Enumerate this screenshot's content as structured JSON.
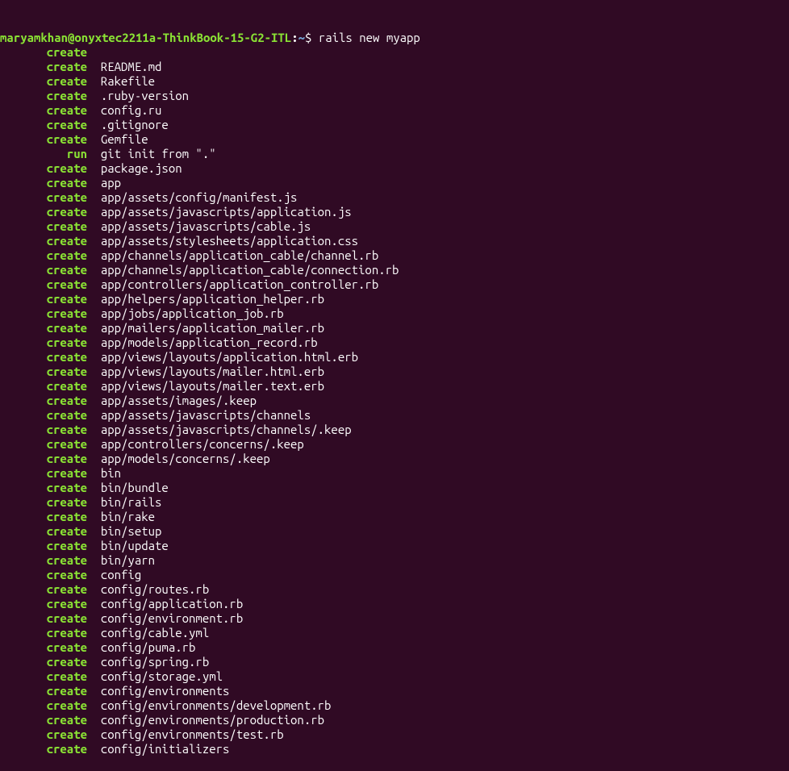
{
  "prompt": {
    "user_host": "maryamkhan@onyxtec2211a-ThinkBook-15-G2-ITL",
    "colon": ":",
    "path": "~",
    "dollar": "$",
    "command": "rails new myapp"
  },
  "lines": [
    {
      "action": "create",
      "path": ""
    },
    {
      "action": "create",
      "path": "README.md"
    },
    {
      "action": "create",
      "path": "Rakefile"
    },
    {
      "action": "create",
      "path": ".ruby-version"
    },
    {
      "action": "create",
      "path": "config.ru"
    },
    {
      "action": "create",
      "path": ".gitignore"
    },
    {
      "action": "create",
      "path": "Gemfile"
    },
    {
      "action": "run",
      "path": "git init from \".\""
    },
    {
      "action": "create",
      "path": "package.json"
    },
    {
      "action": "create",
      "path": "app"
    },
    {
      "action": "create",
      "path": "app/assets/config/manifest.js"
    },
    {
      "action": "create",
      "path": "app/assets/javascripts/application.js"
    },
    {
      "action": "create",
      "path": "app/assets/javascripts/cable.js"
    },
    {
      "action": "create",
      "path": "app/assets/stylesheets/application.css"
    },
    {
      "action": "create",
      "path": "app/channels/application_cable/channel.rb"
    },
    {
      "action": "create",
      "path": "app/channels/application_cable/connection.rb"
    },
    {
      "action": "create",
      "path": "app/controllers/application_controller.rb"
    },
    {
      "action": "create",
      "path": "app/helpers/application_helper.rb"
    },
    {
      "action": "create",
      "path": "app/jobs/application_job.rb"
    },
    {
      "action": "create",
      "path": "app/mailers/application_mailer.rb"
    },
    {
      "action": "create",
      "path": "app/models/application_record.rb"
    },
    {
      "action": "create",
      "path": "app/views/layouts/application.html.erb"
    },
    {
      "action": "create",
      "path": "app/views/layouts/mailer.html.erb"
    },
    {
      "action": "create",
      "path": "app/views/layouts/mailer.text.erb"
    },
    {
      "action": "create",
      "path": "app/assets/images/.keep"
    },
    {
      "action": "create",
      "path": "app/assets/javascripts/channels"
    },
    {
      "action": "create",
      "path": "app/assets/javascripts/channels/.keep"
    },
    {
      "action": "create",
      "path": "app/controllers/concerns/.keep"
    },
    {
      "action": "create",
      "path": "app/models/concerns/.keep"
    },
    {
      "action": "create",
      "path": "bin"
    },
    {
      "action": "create",
      "path": "bin/bundle"
    },
    {
      "action": "create",
      "path": "bin/rails"
    },
    {
      "action": "create",
      "path": "bin/rake"
    },
    {
      "action": "create",
      "path": "bin/setup"
    },
    {
      "action": "create",
      "path": "bin/update"
    },
    {
      "action": "create",
      "path": "bin/yarn"
    },
    {
      "action": "create",
      "path": "config"
    },
    {
      "action": "create",
      "path": "config/routes.rb"
    },
    {
      "action": "create",
      "path": "config/application.rb"
    },
    {
      "action": "create",
      "path": "config/environment.rb"
    },
    {
      "action": "create",
      "path": "config/cable.yml"
    },
    {
      "action": "create",
      "path": "config/puma.rb"
    },
    {
      "action": "create",
      "path": "config/spring.rb"
    },
    {
      "action": "create",
      "path": "config/storage.yml"
    },
    {
      "action": "create",
      "path": "config/environments"
    },
    {
      "action": "create",
      "path": "config/environments/development.rb"
    },
    {
      "action": "create",
      "path": "config/environments/production.rb"
    },
    {
      "action": "create",
      "path": "config/environments/test.rb"
    },
    {
      "action": "create",
      "path": "config/initializers"
    }
  ]
}
